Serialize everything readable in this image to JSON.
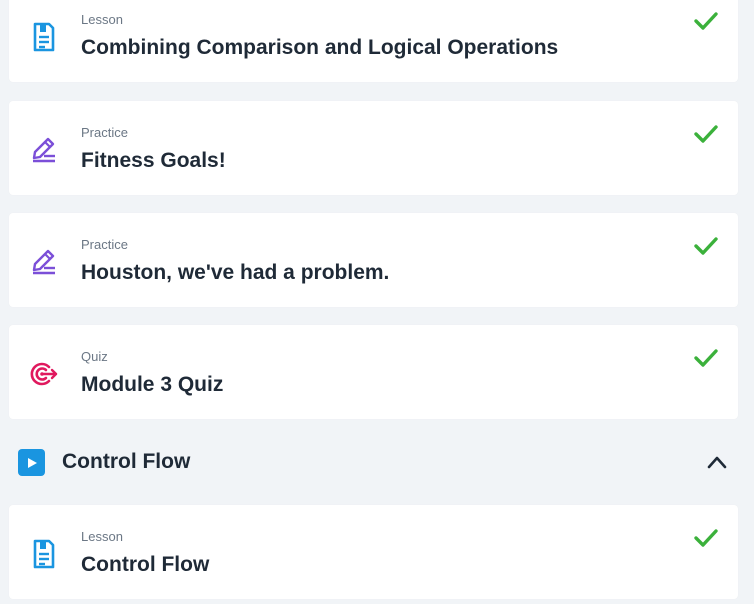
{
  "colors": {
    "background": "#f1f4f7",
    "card": "#ffffff",
    "check": "#3bb13b",
    "lesson_icon": "#1a95e0",
    "practice_icon": "#7b4fd8",
    "quiz_icon": "#e0195e",
    "section_icon": "#1a95e0",
    "title_text": "#1f2a37",
    "type_text": "#6b7785"
  },
  "items": [
    {
      "type": "Lesson",
      "title": "Combining Comparison and Logical Operations",
      "icon": "lesson-document-icon",
      "completed": true
    },
    {
      "type": "Practice",
      "title": "Fitness Goals!",
      "icon": "practice-pencil-icon",
      "completed": true
    },
    {
      "type": "Practice",
      "title": "Houston, we've had a problem.",
      "icon": "practice-pencil-icon",
      "completed": true
    },
    {
      "type": "Quiz",
      "title": "Module 3 Quiz",
      "icon": "quiz-target-icon",
      "completed": true
    }
  ],
  "section": {
    "title": "Control Flow",
    "icon": "video-play-icon",
    "expanded": true,
    "items": [
      {
        "type": "Lesson",
        "title": "Control Flow",
        "icon": "lesson-document-icon",
        "completed": true
      }
    ]
  }
}
